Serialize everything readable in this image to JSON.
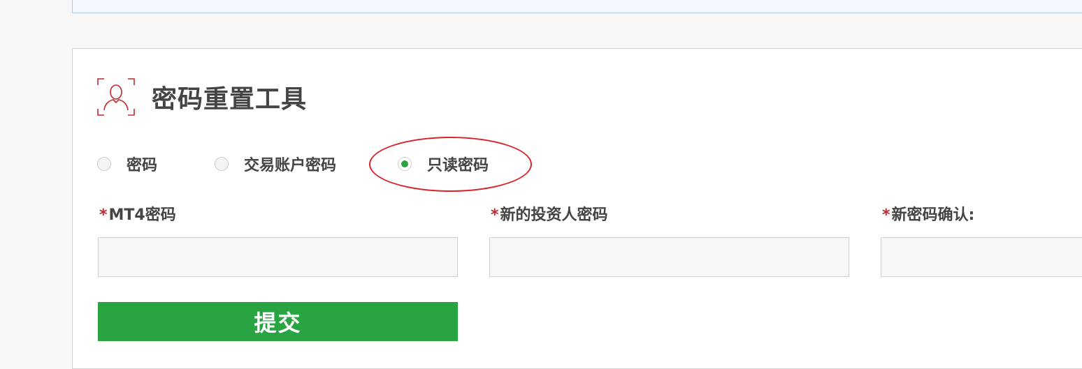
{
  "page": {
    "title": "密码重置工具"
  },
  "password_type": {
    "options": [
      {
        "label": "密码",
        "selected": false
      },
      {
        "label": "交易账户密码",
        "selected": false
      },
      {
        "label": "只读密码",
        "selected": true
      }
    ]
  },
  "form": {
    "required_marker": "*",
    "fields": [
      {
        "label": "MT4密码",
        "value": "",
        "placeholder": ""
      },
      {
        "label": "新的投资人密码",
        "value": "",
        "placeholder": ""
      },
      {
        "label": "新密码确认:",
        "value": "",
        "placeholder": ""
      }
    ],
    "submit_label": "提交"
  },
  "colors": {
    "accent_green": "#29a443",
    "required_red": "#c4262e",
    "icon_red": "#c4262e",
    "annotation_red": "#d9232a"
  },
  "icons": {
    "title_icon": "user-scan-icon"
  }
}
